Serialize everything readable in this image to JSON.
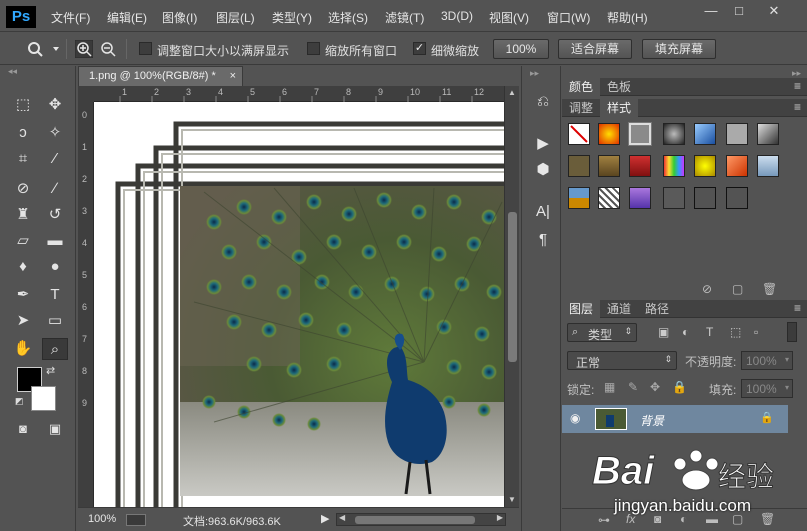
{
  "app": {
    "logo": "Ps"
  },
  "menu": [
    "文件(F)",
    "编辑(E)",
    "图像(I)",
    "图层(L)",
    "类型(Y)",
    "选择(S)",
    "滤镜(T)",
    "3D(D)",
    "视图(V)",
    "窗口(W)",
    "帮助(H)"
  ],
  "window_controls": {
    "minimize": "—",
    "maximize": "□",
    "close": "✕"
  },
  "options": {
    "resize_label": "调整窗口大小以满屏显示",
    "zoom_all_label": "缩放所有窗口",
    "scrubby_label": "细微缩放",
    "scrubby_checked": true,
    "zoom_btn": "100%",
    "fit_btn": "适合屏幕",
    "fill_btn": "填充屏幕"
  },
  "document": {
    "tab_title": "1.png @ 100%(RGB/8#) *",
    "tab_close": "×",
    "ruler_top": [
      "1",
      "2",
      "3",
      "4",
      "5",
      "6",
      "7",
      "8",
      "9",
      "10",
      "11",
      "12"
    ],
    "ruler_left": [
      "0",
      "1",
      "2",
      "3",
      "4",
      "5",
      "6",
      "7",
      "8",
      "9"
    ],
    "zoom": "100%",
    "doc_info": "文档:963.6K/963.6K"
  },
  "panels": {
    "color_tabs": [
      "颜色",
      "色板"
    ],
    "adjust_tabs": [
      "调整",
      "样式"
    ],
    "layers_tabs": [
      "图层",
      "通道",
      "路径"
    ],
    "kind_filter": "类型",
    "blend_mode": "正常",
    "opacity_label": "不透明度:",
    "opacity_value": "100%",
    "lock_label": "锁定:",
    "fill_label": "填充:",
    "fill_value": "100%",
    "layer_name": "背景"
  },
  "watermark": {
    "brand": "Baidu经验",
    "url": "jingyan.baidu.com"
  },
  "colors": {
    "bg": "#535353",
    "accent": "#31a8ff",
    "selected_layer": "#6f879f"
  }
}
